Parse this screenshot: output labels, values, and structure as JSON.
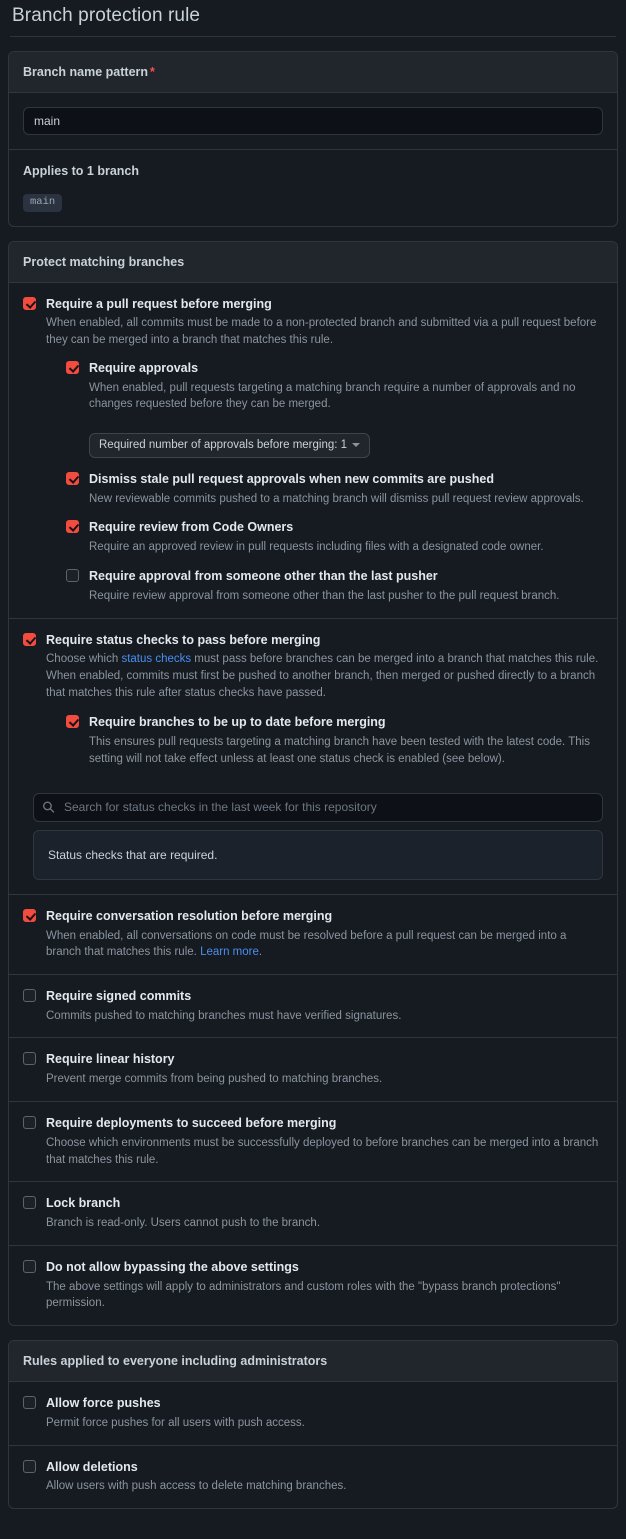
{
  "page": {
    "title": "Branch protection rule"
  },
  "colors": {
    "checkbox_checked": "#f14c3f",
    "link": "#4a8ef0",
    "required_asterisk": "#f85149",
    "card_border": "#30363d",
    "header_bg": "#21262d",
    "page_bg": "#161b22"
  },
  "pattern_card": {
    "header_label": "Branch name pattern",
    "required_mark": "*",
    "input_value": "main",
    "input_placeholder": "",
    "applies_to_label": "Applies to 1 branch",
    "branches": [
      "main"
    ]
  },
  "protect_card": {
    "header_label": "Protect matching branches",
    "rules": [
      {
        "name": "require-pull-request",
        "title": "Require a pull request before merging",
        "desc": "When enabled, all commits must be made to a non-protected branch and submitted via a pull request before they can be merged into a branch that matches this rule.",
        "checked": true
      },
      {
        "name": "require-approvals",
        "title": "Require approvals",
        "desc": "When enabled, pull requests targeting a matching branch require a number of approvals and no changes requested before they can be merged.",
        "checked": true,
        "select_label": "Required number of approvals before merging: 1"
      },
      {
        "name": "dismiss-stale-approvals",
        "title": "Dismiss stale pull request approvals when new commits are pushed",
        "desc": "New reviewable commits pushed to a matching branch will dismiss pull request review approvals.",
        "checked": true
      },
      {
        "name": "require-code-owner-review",
        "title": "Require review from Code Owners",
        "desc": "Require an approved review in pull requests including files with a designated code owner.",
        "checked": true
      },
      {
        "name": "require-approval-other-than-last-pusher",
        "title": "Require approval from someone other than the last pusher",
        "desc": "Require review approval from someone other than the last pusher to the pull request branch.",
        "checked": false
      },
      {
        "name": "require-status-checks",
        "title": "Require status checks to pass before merging",
        "desc_part1": "Choose which ",
        "desc_link": "status checks",
        "desc_part2": " must pass before branches can be merged into a branch that matches this rule. When enabled, commits must first be pushed to another branch, then merged or pushed directly to a branch that matches this rule after status checks have passed.",
        "checked": true
      },
      {
        "name": "require-branches-up-to-date",
        "title": "Require branches to be up to date before merging",
        "desc": "This ensures pull requests targeting a matching branch have been tested with the latest code. This setting will not take effect unless at least one status check is enabled (see below).",
        "checked": true
      },
      {
        "name": "status-checks-search",
        "search_placeholder": "Search for status checks in the last week for this repository",
        "search_value": "",
        "panel_text": "Status checks that are required."
      },
      {
        "name": "require-conversation-resolution",
        "title": "Require conversation resolution before merging",
        "desc_part1": "When enabled, all conversations on code must be resolved before a pull request can be merged into a branch that matches this rule. ",
        "desc_link": "Learn more",
        "desc_part2": ".",
        "checked": true
      },
      {
        "name": "require-signed-commits",
        "title": "Require signed commits",
        "desc": "Commits pushed to matching branches must have verified signatures.",
        "checked": false
      },
      {
        "name": "require-linear-history",
        "title": "Require linear history",
        "desc": "Prevent merge commits from being pushed to matching branches.",
        "checked": false
      },
      {
        "name": "require-deployments",
        "title": "Require deployments to succeed before merging",
        "desc": "Choose which environments must be successfully deployed to before branches can be merged into a branch that matches this rule.",
        "checked": false
      },
      {
        "name": "lock-branch",
        "title": "Lock branch",
        "desc": "Branch is read-only. Users cannot push to the branch.",
        "checked": false
      },
      {
        "name": "do-not-allow-bypassing",
        "title": "Do not allow bypassing the above settings",
        "desc": "The above settings will apply to administrators and custom roles with the \"bypass branch protections\" permission.",
        "checked": false
      }
    ]
  },
  "everyone_card": {
    "header_label": "Rules applied to everyone including administrators",
    "rules": [
      {
        "name": "allow-force-pushes",
        "title": "Allow force pushes",
        "desc": "Permit force pushes for all users with push access.",
        "checked": false
      },
      {
        "name": "allow-deletions",
        "title": "Allow deletions",
        "desc": "Allow users with push access to delete matching branches.",
        "checked": false
      }
    ]
  }
}
